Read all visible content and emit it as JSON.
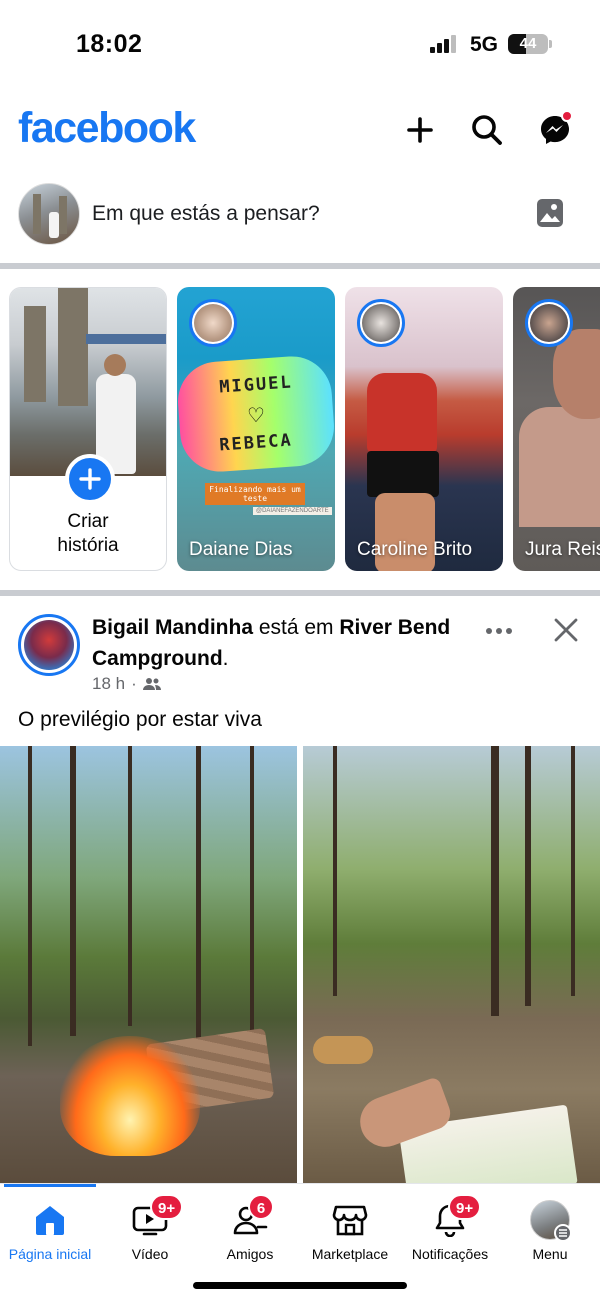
{
  "status_bar": {
    "time": "18:02",
    "network": "5G",
    "battery": "44"
  },
  "header": {
    "logo": "facebook",
    "icons": [
      "plus-icon",
      "search-icon",
      "messenger-icon"
    ],
    "messenger_badge_color": "#e41e3f"
  },
  "composer": {
    "placeholder": "Em que estás a pensar?"
  },
  "stories": [
    {
      "type": "create",
      "label_line1": "Criar",
      "label_line2": "história"
    },
    {
      "name": "Daiane Dias",
      "text_line1": "MIGUEL",
      "text_line2": "REBECA",
      "caption": "Finalizando mais um teste",
      "tag": "@DAIANEFAZENDOARTE"
    },
    {
      "name": "Caroline Brito"
    },
    {
      "name": "Jura Reis"
    }
  ],
  "post": {
    "author": "Bigail Mandinha",
    "verb": " está em ",
    "place": "River Bend Campground",
    "place_suffix": ".",
    "time": "18 h",
    "separator": "·",
    "audience_icon": "friends-icon",
    "text": "O previlégio por estar viva"
  },
  "tabs": [
    {
      "label": "Página inicial",
      "icon": "home-icon",
      "active": true
    },
    {
      "label": "Vídeo",
      "icon": "video-icon",
      "badge": "9+"
    },
    {
      "label": "Amigos",
      "icon": "friends-icon",
      "badge": "6"
    },
    {
      "label": "Marketplace",
      "icon": "marketplace-icon"
    },
    {
      "label": "Notificações",
      "icon": "bell-icon",
      "badge": "9+"
    },
    {
      "label": "Menu",
      "icon": "menu-avatar"
    }
  ],
  "colors": {
    "brand": "#1877f2",
    "badge": "#e41e3f",
    "divider": "#c9ccd1"
  }
}
